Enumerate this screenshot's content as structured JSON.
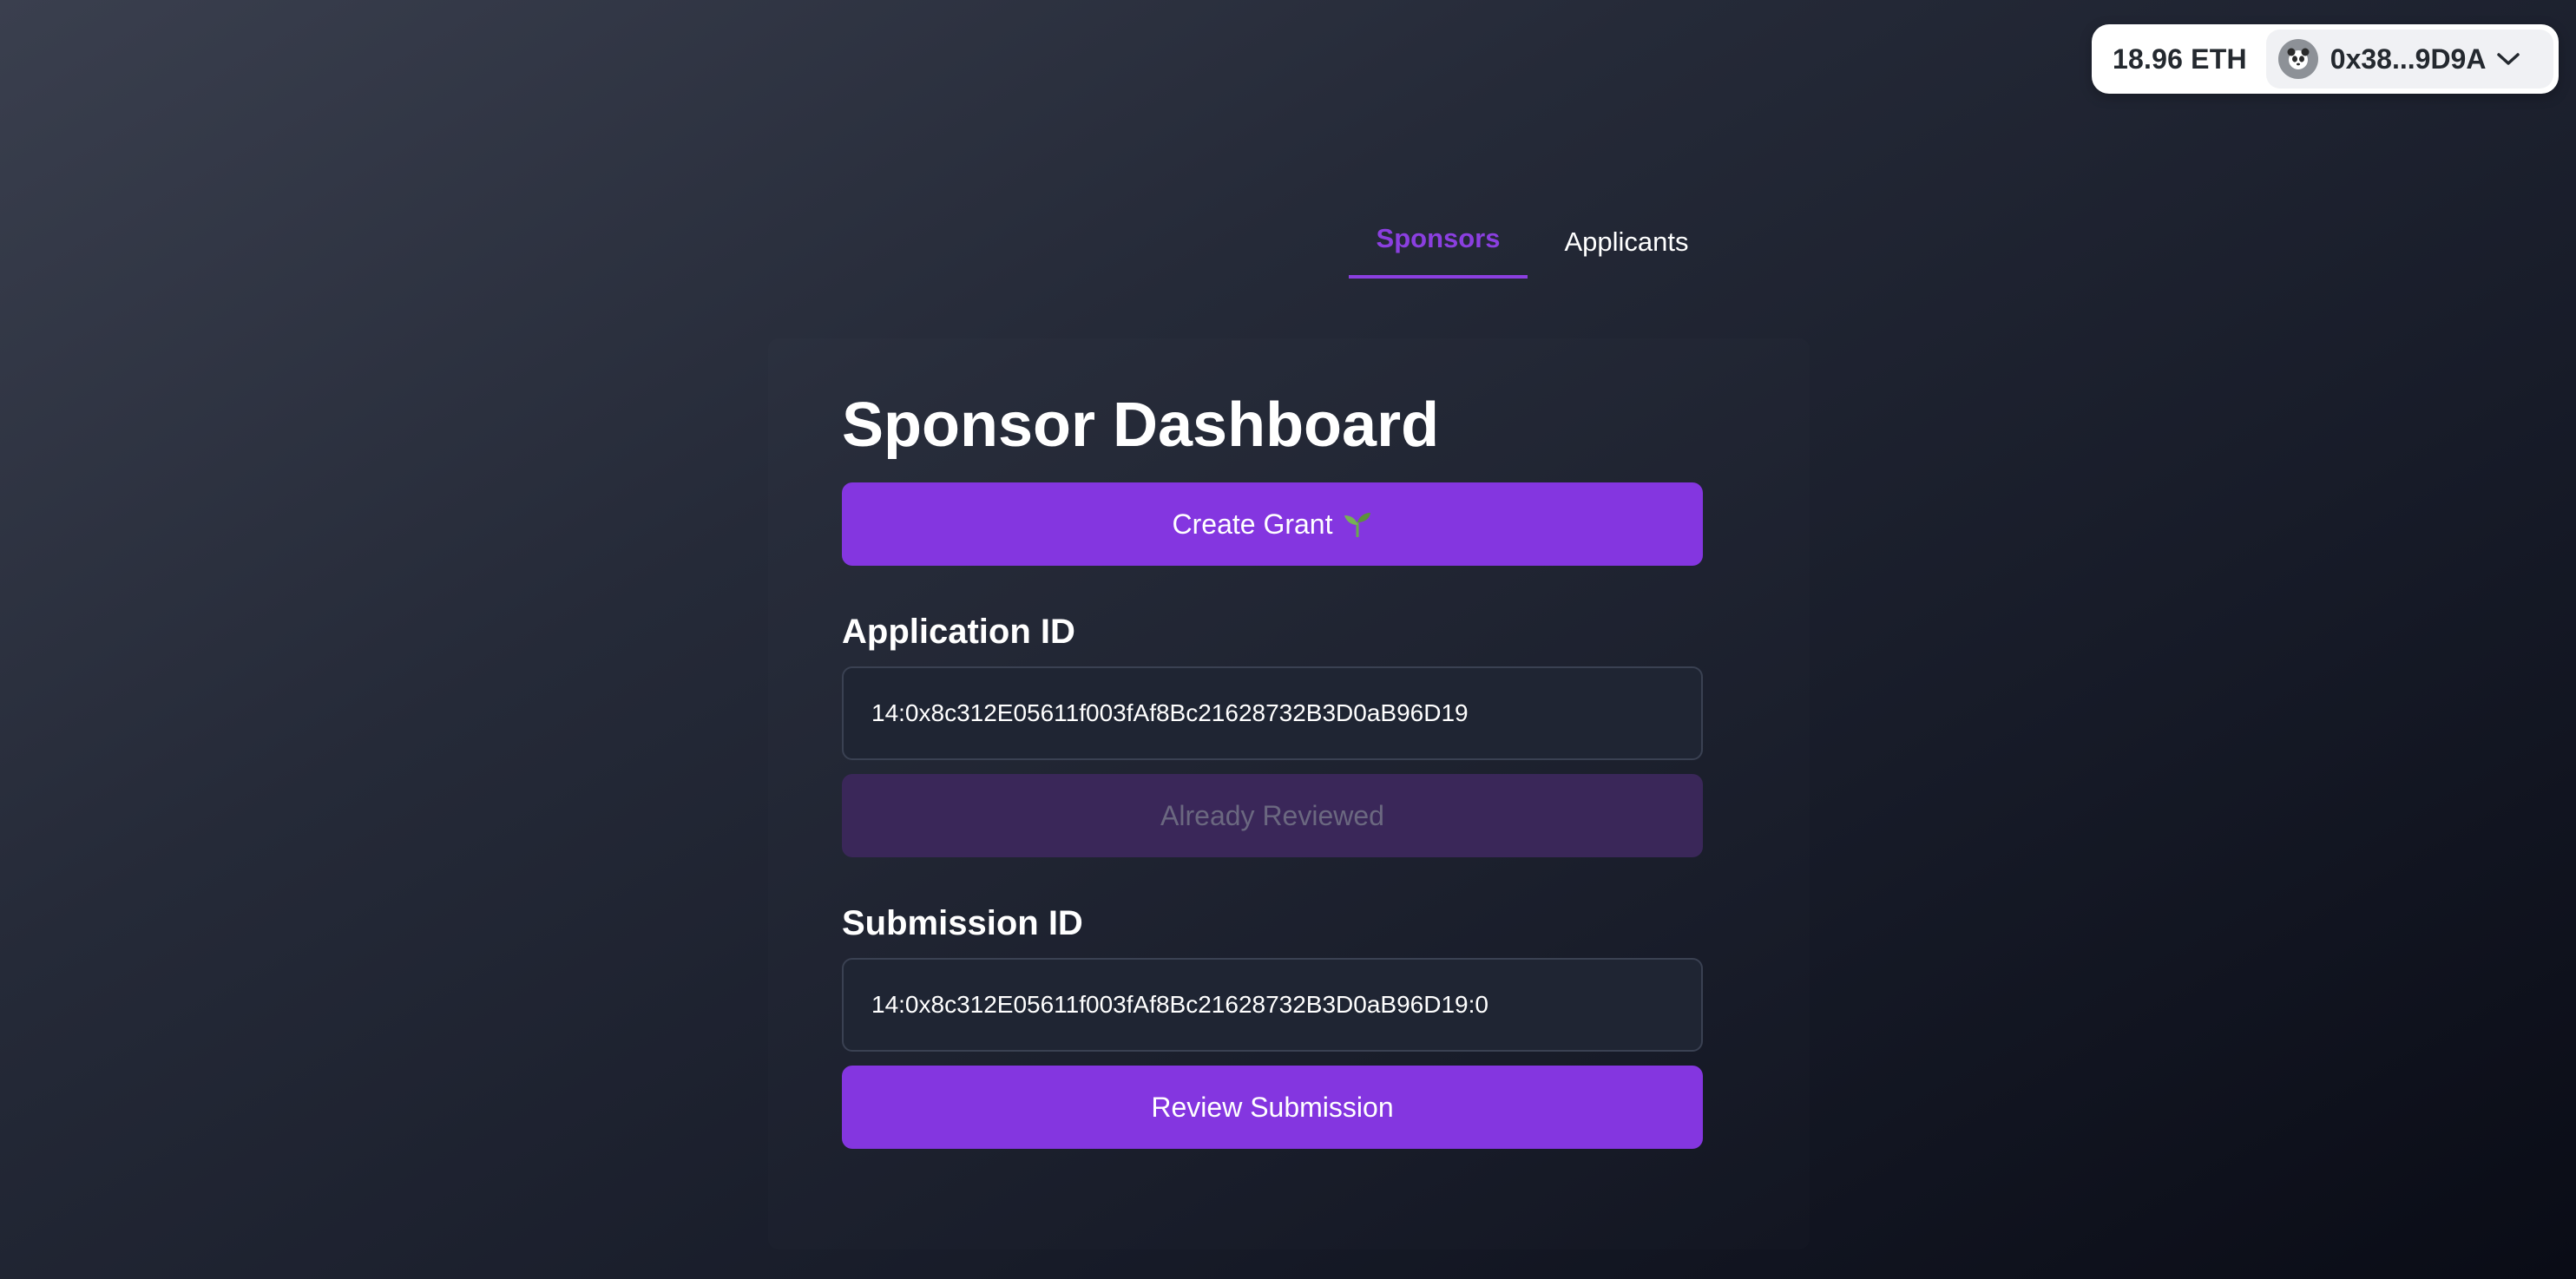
{
  "wallet": {
    "balance": "18.96 ETH",
    "address": "0x38...9D9A",
    "avatar_icon": "panda-avatar-icon"
  },
  "tabs": [
    {
      "label": "Sponsors",
      "active": true
    },
    {
      "label": "Applicants",
      "active": false
    }
  ],
  "dashboard": {
    "title": "Sponsor Dashboard",
    "create_grant_label": "Create Grant",
    "create_grant_icon": "seedling-icon",
    "application": {
      "label": "Application ID",
      "value": "14:0x8c312E05611f003fAf8Bc21628732B3D0aB96D19",
      "button_label": "Already Reviewed"
    },
    "submission": {
      "label": "Submission ID",
      "value": "14:0x8c312E05611f003fAf8Bc21628732B3D0aB96D19:0",
      "button_label": "Review Submission"
    }
  },
  "colors": {
    "accent": "#8436e0",
    "tab_active": "#8b3fe0",
    "disabled_button": "#3a2759"
  }
}
